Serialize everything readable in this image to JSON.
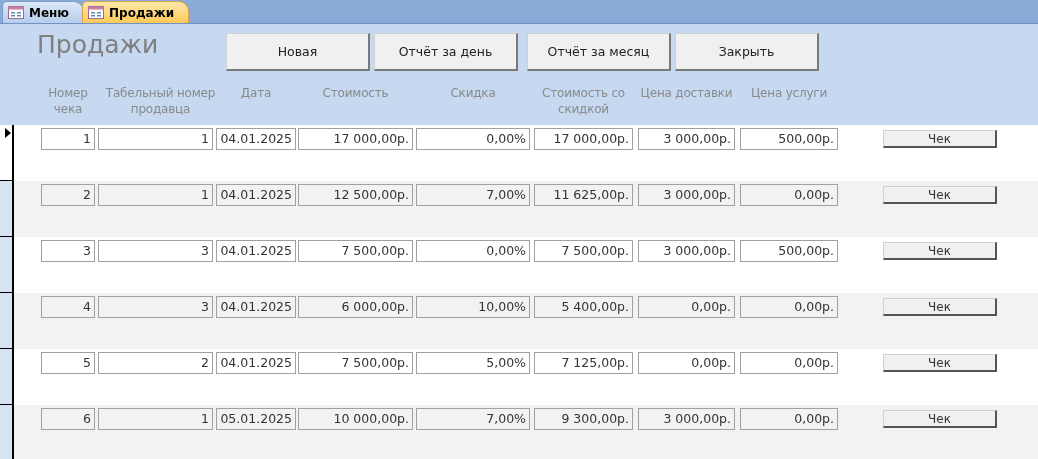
{
  "tabs": [
    {
      "label": "Меню",
      "selected": false
    },
    {
      "label": "Продажи",
      "selected": true
    }
  ],
  "form_title": "Продажи",
  "buttons": [
    "Новая",
    "Отчёт за день",
    "Отчёт за месяц",
    "Закрыть"
  ],
  "columns": [
    "Номер чека",
    "Табельный номер продавца",
    "Дата",
    "Стоимость",
    "Скидка",
    "Стоимость со скидкой",
    "Цена доставки",
    "Цена услуги"
  ],
  "rows": [
    {
      "selected": true,
      "cells": [
        "1",
        "1",
        "04.01.2025",
        "17 000,00р.",
        "0,00%",
        "17 000,00р.",
        "3 000,00р.",
        "500,00р."
      ],
      "button": "Чек"
    },
    {
      "selected": false,
      "cells": [
        "2",
        "1",
        "04.01.2025",
        "12 500,00р.",
        "7,00%",
        "11 625,00р.",
        "3 000,00р.",
        "0,00р."
      ],
      "button": "Чек"
    },
    {
      "selected": false,
      "cells": [
        "3",
        "3",
        "04.01.2025",
        "7 500,00р.",
        "0,00%",
        "7 500,00р.",
        "3 000,00р.",
        "500,00р."
      ],
      "button": "Чек"
    },
    {
      "selected": false,
      "cells": [
        "4",
        "3",
        "04.01.2025",
        "6 000,00р.",
        "10,00%",
        "5 400,00р.",
        "0,00р.",
        "0,00р."
      ],
      "button": "Чек"
    },
    {
      "selected": false,
      "cells": [
        "5",
        "2",
        "04.01.2025",
        "7 500,00р.",
        "5,00%",
        "7 125,00р.",
        "0,00р.",
        "0,00р."
      ],
      "button": "Чек"
    },
    {
      "selected": false,
      "cells": [
        "6",
        "1",
        "05.01.2025",
        "10 000,00р.",
        "7,00%",
        "9 300,00р.",
        "3 000,00р.",
        "0,00р."
      ],
      "button": "Чек"
    }
  ]
}
